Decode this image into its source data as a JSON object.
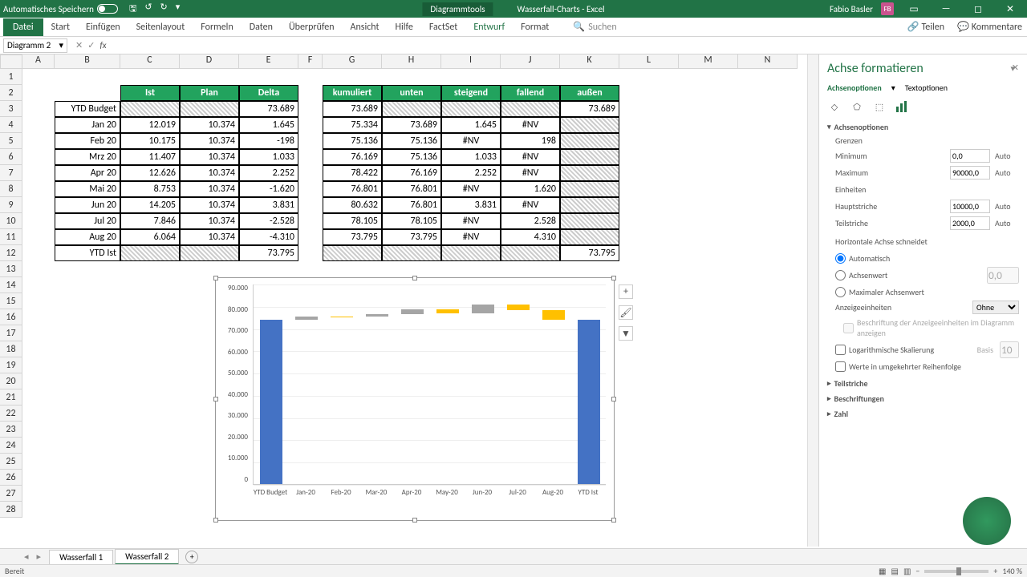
{
  "title": {
    "autosave": "Automatisches Speichern",
    "tools": "Diagrammtools",
    "doc": "Wasserfall-Charts - Excel",
    "user": "Fabio Basler",
    "badge": "FB"
  },
  "ribbon": {
    "file": "Datei",
    "tabs": [
      "Start",
      "Einfügen",
      "Seitenlayout",
      "Formeln",
      "Daten",
      "Überprüfen",
      "Ansicht",
      "Hilfe",
      "FactSet",
      "Entwurf",
      "Format"
    ],
    "active": "Entwurf",
    "search": "Suchen",
    "share": "Teilen",
    "comments": "Kommentare"
  },
  "namebox": "Diagramm 2",
  "cols": [
    "A",
    "B",
    "C",
    "D",
    "E",
    "F",
    "G",
    "H",
    "I",
    "J",
    "K",
    "L",
    "M",
    "N"
  ],
  "table1": {
    "headers": [
      "Ist",
      "Plan",
      "Delta"
    ],
    "rows": [
      {
        "label": "YTD Budget",
        "ist": "",
        "plan": "",
        "delta": "73.689"
      },
      {
        "label": "Jan 20",
        "ist": "12.019",
        "plan": "10.374",
        "delta": "1.645"
      },
      {
        "label": "Feb 20",
        "ist": "10.175",
        "plan": "10.374",
        "delta": "-198"
      },
      {
        "label": "Mrz 20",
        "ist": "11.407",
        "plan": "10.374",
        "delta": "1.033"
      },
      {
        "label": "Apr 20",
        "ist": "12.626",
        "plan": "10.374",
        "delta": "2.252"
      },
      {
        "label": "Mai 20",
        "ist": "8.753",
        "plan": "10.374",
        "delta": "-1.620"
      },
      {
        "label": "Jun 20",
        "ist": "14.205",
        "plan": "10.374",
        "delta": "3.831"
      },
      {
        "label": "Jul 20",
        "ist": "7.846",
        "plan": "10.374",
        "delta": "-2.528"
      },
      {
        "label": "Aug 20",
        "ist": "6.064",
        "plan": "10.374",
        "delta": "-4.310"
      },
      {
        "label": "YTD Ist",
        "ist": "",
        "plan": "",
        "delta": "73.795"
      }
    ]
  },
  "table2": {
    "headers": [
      "kumuliert",
      "unten",
      "steigend",
      "fallend",
      "außen"
    ],
    "rows": [
      {
        "k": "73.689",
        "u": "",
        "s": "",
        "f": "",
        "a": "73.689"
      },
      {
        "k": "75.334",
        "u": "73.689",
        "s": "1.645",
        "f": "#NV",
        "a": ""
      },
      {
        "k": "75.136",
        "u": "75.136",
        "s": "#NV",
        "f": "198",
        "a": ""
      },
      {
        "k": "76.169",
        "u": "75.136",
        "s": "1.033",
        "f": "#NV",
        "a": ""
      },
      {
        "k": "78.422",
        "u": "76.169",
        "s": "2.252",
        "f": "#NV",
        "a": ""
      },
      {
        "k": "76.801",
        "u": "76.801",
        "s": "#NV",
        "f": "1.620",
        "a": ""
      },
      {
        "k": "80.632",
        "u": "76.801",
        "s": "3.831",
        "f": "#NV",
        "a": ""
      },
      {
        "k": "78.105",
        "u": "78.105",
        "s": "#NV",
        "f": "2.528",
        "a": ""
      },
      {
        "k": "73.795",
        "u": "73.795",
        "s": "#NV",
        "f": "4.310",
        "a": ""
      },
      {
        "k": "",
        "u": "",
        "s": "",
        "f": "",
        "a": "73.795"
      }
    ]
  },
  "chart_data": {
    "type": "bar",
    "title": "",
    "ylim": [
      0,
      90000
    ],
    "yticks": [
      "90.000",
      "80.000",
      "70.000",
      "60.000",
      "50.000",
      "40.000",
      "30.000",
      "20.000",
      "10.000",
      "0"
    ],
    "categories": [
      "YTD Budget",
      "Jan-20",
      "Feb-20",
      "Mar-20",
      "Apr-20",
      "May-20",
      "Jun-20",
      "Jul-20",
      "Aug-20",
      "YTD Ist"
    ],
    "series": [
      {
        "name": "außen",
        "color": "#4472C4",
        "values": [
          73689,
          0,
          0,
          0,
          0,
          0,
          0,
          0,
          0,
          73795
        ]
      },
      {
        "name": "unten",
        "color": "transparent",
        "values": [
          0,
          73689,
          75136,
          75136,
          76169,
          76801,
          76801,
          78105,
          73795,
          0
        ]
      },
      {
        "name": "steigend",
        "color": "#A5A5A5",
        "values": [
          0,
          1645,
          0,
          1033,
          2252,
          0,
          3831,
          0,
          0,
          0
        ]
      },
      {
        "name": "fallend",
        "color": "#FFC000",
        "values": [
          0,
          0,
          198,
          0,
          0,
          1620,
          0,
          2528,
          4310,
          0
        ]
      }
    ]
  },
  "pane": {
    "title": "Achse formatieren",
    "subtabs": [
      "Achsenoptionen",
      "Textoptionen"
    ],
    "section_axis": "Achsenoptionen",
    "bounds": "Grenzen",
    "min": "Minimum",
    "min_val": "0,0",
    "max": "Maximum",
    "max_val": "90000,0",
    "units": "Einheiten",
    "major": "Hauptstriche",
    "major_val": "10000,0",
    "minor": "Teilstriche",
    "minor_val": "2000,0",
    "auto": "Auto",
    "crosses": "Horizontale Achse schneidet",
    "r1": "Automatisch",
    "r2": "Achsenwert",
    "r2_val": "0,0",
    "r3": "Maximaler Achsenwert",
    "display_units": "Anzeigeeinheiten",
    "display_units_val": "Ohne",
    "display_units_label": "Beschriftung der Anzeigeeinheiten im Diagramm anzeigen",
    "log": "Logarithmische Skalierung",
    "log_base_lbl": "Basis",
    "log_base": "10",
    "reverse": "Werte in umgekehrter Reihenfolge",
    "ticks": "Teilstriche",
    "labels": "Beschriftungen",
    "number": "Zahl"
  },
  "sheets": {
    "t1": "Wasserfall 1",
    "t2": "Wasserfall 2"
  },
  "status": {
    "ready": "Bereit",
    "zoom": "140 %"
  }
}
